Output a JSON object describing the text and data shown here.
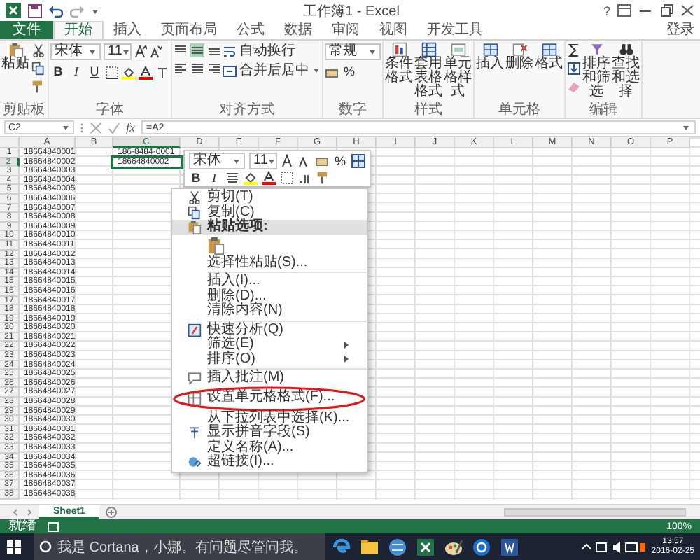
{
  "window": {
    "title": "工作簿1 - Excel",
    "help": "?",
    "sign_in": "登录"
  },
  "tabs": [
    {
      "label": "文件",
      "kind": "file",
      "selected": false
    },
    {
      "label": "开始",
      "kind": "tab",
      "selected": true
    },
    {
      "label": "插入",
      "kind": "tab",
      "selected": false
    },
    {
      "label": "页面布局",
      "kind": "tab",
      "selected": false
    },
    {
      "label": "公式",
      "kind": "tab",
      "selected": false
    },
    {
      "label": "数据",
      "kind": "tab",
      "selected": false
    },
    {
      "label": "审阅",
      "kind": "tab",
      "selected": false
    },
    {
      "label": "视图",
      "kind": "tab",
      "selected": false
    },
    {
      "label": "开发工具",
      "kind": "tab",
      "selected": false
    }
  ],
  "ribbon": {
    "clipboard": {
      "label": "剪贴板",
      "paste": "粘贴"
    },
    "font": {
      "label": "字体",
      "font": "宋体",
      "size": "11",
      "bold": "B",
      "italic": "I",
      "underline": "U"
    },
    "alignment": {
      "label": "对齐方式",
      "wrap": "自动换行",
      "merge": "合并后居中"
    },
    "number": {
      "label": "数字",
      "format": "常规",
      "percent": "%"
    },
    "styles": {
      "label": "样式",
      "buttons": [
        "条件格式",
        "套用表格格式",
        "单元格样式"
      ]
    },
    "cells": {
      "label": "单元格",
      "buttons": [
        "插入",
        "删除",
        "格式"
      ]
    },
    "editing": {
      "label": "编辑",
      "buttons": [
        "排序和筛选",
        "查找和选择"
      ]
    }
  },
  "formula_bar": {
    "name_box": "C2",
    "function_symbol": "fx",
    "formula": "=A2"
  },
  "sheet": {
    "columns": [
      {
        "label": "A",
        "selected": false
      },
      {
        "label": "B",
        "selected": false
      },
      {
        "label": "C",
        "selected": true
      },
      {
        "label": "D",
        "selected": false
      },
      {
        "label": "E",
        "selected": false
      },
      {
        "label": "F",
        "selected": false
      },
      {
        "label": "G",
        "selected": false
      },
      {
        "label": "H",
        "selected": false
      },
      {
        "label": "I",
        "selected": false
      },
      {
        "label": "J",
        "selected": false
      },
      {
        "label": "K",
        "selected": false
      },
      {
        "label": "L",
        "selected": false
      },
      {
        "label": "M",
        "selected": false
      },
      {
        "label": "N",
        "selected": false
      },
      {
        "label": "O",
        "selected": false
      },
      {
        "label": "P",
        "selected": false
      }
    ],
    "rows": [
      {
        "number": "1",
        "selected": false,
        "cells": [
          "18664840001",
          null,
          "186-8484-0001"
        ]
      },
      {
        "number": "2",
        "selected": true,
        "cells": [
          "18664840002",
          null,
          "18664840002"
        ]
      },
      {
        "number": "3",
        "selected": false,
        "cells": [
          "18664840003"
        ]
      },
      {
        "number": "4",
        "selected": false,
        "cells": [
          "18664840004"
        ]
      },
      {
        "number": "5",
        "selected": false,
        "cells": [
          "18664840005"
        ]
      },
      {
        "number": "6",
        "selected": false,
        "cells": [
          "18664840006"
        ]
      },
      {
        "number": "7",
        "selected": false,
        "cells": [
          "18664840007"
        ]
      },
      {
        "number": "8",
        "selected": false,
        "cells": [
          "18664840008"
        ]
      },
      {
        "number": "9",
        "selected": false,
        "cells": [
          "18664840009"
        ]
      },
      {
        "number": "10",
        "selected": false,
        "cells": [
          "18664840010"
        ]
      },
      {
        "number": "11",
        "selected": false,
        "cells": [
          "18664840011"
        ]
      },
      {
        "number": "12",
        "selected": false,
        "cells": [
          "18664840012"
        ]
      },
      {
        "number": "13",
        "selected": false,
        "cells": [
          "18664840013"
        ]
      },
      {
        "number": "14",
        "selected": false,
        "cells": [
          "18664840014"
        ]
      },
      {
        "number": "15",
        "selected": false,
        "cells": [
          "18664840015"
        ]
      },
      {
        "number": "16",
        "selected": false,
        "cells": [
          "18664840016"
        ]
      },
      {
        "number": "17",
        "selected": false,
        "cells": [
          "18664840017"
        ]
      },
      {
        "number": "18",
        "selected": false,
        "cells": [
          "18664840018"
        ]
      },
      {
        "number": "19",
        "selected": false,
        "cells": [
          "18664840019"
        ]
      },
      {
        "number": "20",
        "selected": false,
        "cells": [
          "18664840020"
        ]
      },
      {
        "number": "21",
        "selected": false,
        "cells": [
          "18664840021"
        ]
      },
      {
        "number": "22",
        "selected": false,
        "cells": [
          "18664840022"
        ]
      },
      {
        "number": "23",
        "selected": false,
        "cells": [
          "18664840023"
        ]
      },
      {
        "number": "24",
        "selected": false,
        "cells": [
          "18664840024"
        ]
      },
      {
        "number": "25",
        "selected": false,
        "cells": [
          "18664840025"
        ]
      },
      {
        "number": "26",
        "selected": false,
        "cells": [
          "18664840026"
        ]
      },
      {
        "number": "27",
        "selected": false,
        "cells": [
          "18664840027"
        ]
      },
      {
        "number": "28",
        "selected": false,
        "cells": [
          "18664840028"
        ]
      },
      {
        "number": "29",
        "selected": false,
        "cells": [
          "18664840029"
        ]
      },
      {
        "number": "30",
        "selected": false,
        "cells": [
          "18664840030"
        ]
      },
      {
        "number": "31",
        "selected": false,
        "cells": [
          "18664840031"
        ]
      },
      {
        "number": "32",
        "selected": false,
        "cells": [
          "18664840032"
        ]
      },
      {
        "number": "33",
        "selected": false,
        "cells": [
          "18664840033"
        ]
      },
      {
        "number": "34",
        "selected": false,
        "cells": [
          "18664840034"
        ]
      },
      {
        "number": "35",
        "selected": false,
        "cells": [
          "18664840035"
        ]
      },
      {
        "number": "36",
        "selected": false,
        "cells": [
          "18664840036"
        ]
      },
      {
        "number": "37",
        "selected": false,
        "cells": [
          "18664840037"
        ]
      },
      {
        "number": "38",
        "selected": false,
        "cells": [
          "18664840038"
        ]
      }
    ]
  },
  "mini_toolbar": {
    "font": "宋体",
    "size": "11",
    "percent": "%",
    "bold": "B",
    "italic": "I"
  },
  "context_menu": {
    "items": [
      {
        "kind": "item",
        "label": "剪切(T)",
        "highlighted": false,
        "annotated": false
      },
      {
        "kind": "item",
        "label": "复制(C)",
        "highlighted": false,
        "annotated": false
      },
      {
        "kind": "header",
        "label": "粘贴选项:",
        "highlighted": true,
        "annotated": false
      },
      {
        "kind": "paste_icons"
      },
      {
        "kind": "item",
        "label": "选择性粘贴(S)...",
        "highlighted": false,
        "annotated": false
      },
      {
        "kind": "separator"
      },
      {
        "kind": "item",
        "label": "插入(I)...",
        "highlighted": false,
        "annotated": false
      },
      {
        "kind": "item",
        "label": "删除(D)...",
        "highlighted": false,
        "annotated": false
      },
      {
        "kind": "item",
        "label": "清除内容(N)",
        "highlighted": false,
        "annotated": false
      },
      {
        "kind": "separator"
      },
      {
        "kind": "item",
        "label": "快速分析(Q)",
        "highlighted": false,
        "annotated": false
      },
      {
        "kind": "submenu",
        "label": "筛选(E)",
        "highlighted": false,
        "annotated": false
      },
      {
        "kind": "submenu",
        "label": "排序(O)",
        "highlighted": false,
        "annotated": false
      },
      {
        "kind": "separator"
      },
      {
        "kind": "item",
        "label": "插入批注(M)",
        "highlighted": false,
        "annotated": false
      },
      {
        "kind": "item",
        "label": "设置单元格格式(F)...",
        "highlighted": false,
        "annotated": true
      },
      {
        "kind": "item",
        "label": "从下拉列表中选择(K)...",
        "highlighted": false,
        "annotated": false
      },
      {
        "kind": "item",
        "label": "显示拼音字段(S)",
        "highlighted": false,
        "annotated": false
      },
      {
        "kind": "item",
        "label": "定义名称(A)...",
        "highlighted": false,
        "annotated": false
      },
      {
        "kind": "item",
        "label": "超链接(I)...",
        "highlighted": false,
        "annotated": false
      }
    ]
  },
  "sheet_tabs": [
    {
      "label": "Sheet1",
      "selected": true
    }
  ],
  "status_bar": {
    "status": "就绪",
    "zoom": "100%"
  },
  "taskbar": {
    "search": "我是 Cortana，小娜。有问题尽管问我。",
    "time": "13:57",
    "date": "2016-02-25"
  }
}
